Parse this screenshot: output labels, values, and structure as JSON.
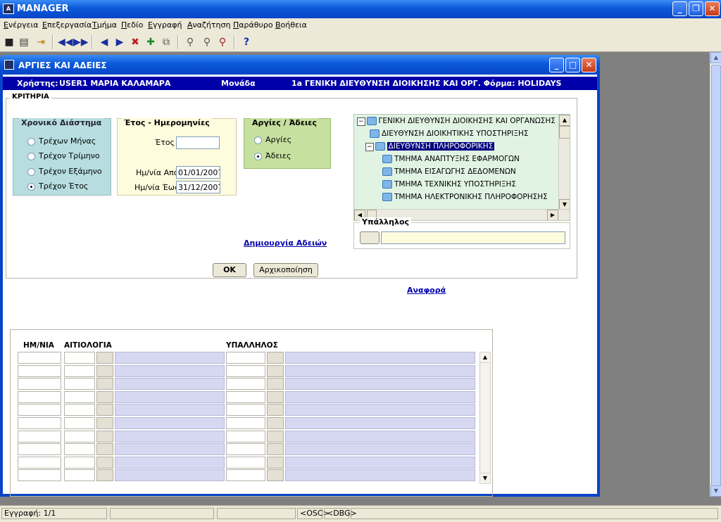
{
  "app": {
    "title": "MANAGER",
    "logo": "A"
  },
  "menu": [
    "Ενέργεια",
    "Επεξεργασία",
    "Τμήμα",
    "Πεδίο",
    "Εγγραφή",
    "Αναζήτηση",
    "Παράθυρο",
    "Βοήθεια"
  ],
  "toolbar_icons": [
    "save-icon",
    "print-icon",
    "exit-icon",
    "first-record-icon",
    "previous-page-icon",
    "previous-record-icon",
    "next-record-icon",
    "delete-record-icon",
    "insert-record-icon",
    "duplicate-record-icon",
    "query-icon",
    "execute-query-icon",
    "cancel-query-icon",
    "help-icon"
  ],
  "window": {
    "title": "ΑΡΓΙΕΣ ΚΑΙ ΑΔΕΙΕΣ",
    "user_label": "Χρήστης:",
    "user": "USER1  ΜΑΡΙΑ ΚΑΛΑΜΑΡΑ",
    "unit_label": "Μονάδα",
    "unit_form": "1a ΓΕΝΙΚΗ ΔΙΕΥΘΥΝΣΗ ΔΙΟΙΚΗΣΗΣ ΚΑΙ ΟΡΓ. Φόρμα: HOLIDAYS"
  },
  "criteria": {
    "title": "ΚΡΙΤΗΡΙΑ",
    "period": {
      "title": "Χρονικό Διάστημα",
      "options": [
        "Τρέχων Μήνας",
        "Τρέχον Τρίμηνο",
        "Τρέχον Εξάμηνο",
        "Τρέχον Έτος"
      ],
      "selected": 3
    },
    "year_dates": {
      "title": "Έτος - Ημερομηνίες",
      "year_label": "Έτος",
      "year_value": "",
      "from_label": "Ημ/νία Από",
      "from_value": "01/01/2007",
      "to_label": "Ημ/νία Έως",
      "to_value": "31/12/2007"
    },
    "holidays": {
      "title": "Αργίες / Άδειες",
      "options": [
        "Αργίες",
        "Άδειες"
      ],
      "selected": 1
    },
    "create_leaves_link": "Δημιουργία Αδειών",
    "tree": [
      {
        "label": "ΓΕΝΙΚΗ ΔΙΕΥΘΥΝΣΗ ΔΙΟΙΚΗΣΗΣ ΚΑΙ ΟΡΓΑΝΩΣΗΣ",
        "level": 0,
        "expander": "−"
      },
      {
        "label": "ΔΙΕΥΘΥΝΣΗ ΔΙΟΙΚΗΤΙΚΗΣ ΥΠΟΣΤΗΡΙΞΗΣ",
        "level": 1,
        "expander": ""
      },
      {
        "label": "ΔΙΕΥΘΥΝΣΗ ΠΛΗΡΟΦΟΡΙΚΗΣ",
        "level": 1,
        "expander": "−",
        "selected": true
      },
      {
        "label": "ΤΜΗΜΑ ΑΝΑΠΤΥΞΗΣ ΕΦΑΡΜΟΓΩΝ",
        "level": 2,
        "expander": ""
      },
      {
        "label": "ΤΜΗΜΑ ΕΙΣΑΓΩΓΗΣ ΔΕΔΟΜΕΝΩΝ",
        "level": 2,
        "expander": ""
      },
      {
        "label": "ΤΜΗΜΑ ΤΕΧΝΙΚΗΣ ΥΠΟΣΤΗΡΙΞΗΣ",
        "level": 2,
        "expander": ""
      },
      {
        "label": "ΤΜΗΜΑ ΗΛΕΚΤΡΟΝΙΚΗΣ ΠΛΗΡΟΦΟΡΗΣΗΣ",
        "level": 2,
        "expander": ""
      }
    ],
    "employee": {
      "title": "Υπάλληλος",
      "value": ""
    },
    "ok_label": "OK",
    "reset_label": "Αρχικοποίηση"
  },
  "report_link": "Αναφορά",
  "grid": {
    "headers": {
      "date": "ΗΜ/ΝΙΑ",
      "reason": "ΑΙΤΙΟΛΟΓΙΑ",
      "employee": "ΥΠΑΛΛΗΛΟΣ"
    },
    "row_count": 10
  },
  "status": {
    "record": "Εγγραφή: 1/1",
    "osc": "<OSC>",
    "dbg": "<DBG>"
  },
  "colors": {
    "titlebar": "#0a58d8",
    "userbar": "#0000a8",
    "period_panel": "#b7dde0",
    "year_panel": "#fffbdd",
    "holiday_panel": "#c6e0a0",
    "tree_bg": "#e1f4e4",
    "grid_lavender": "#d6d8f2"
  }
}
